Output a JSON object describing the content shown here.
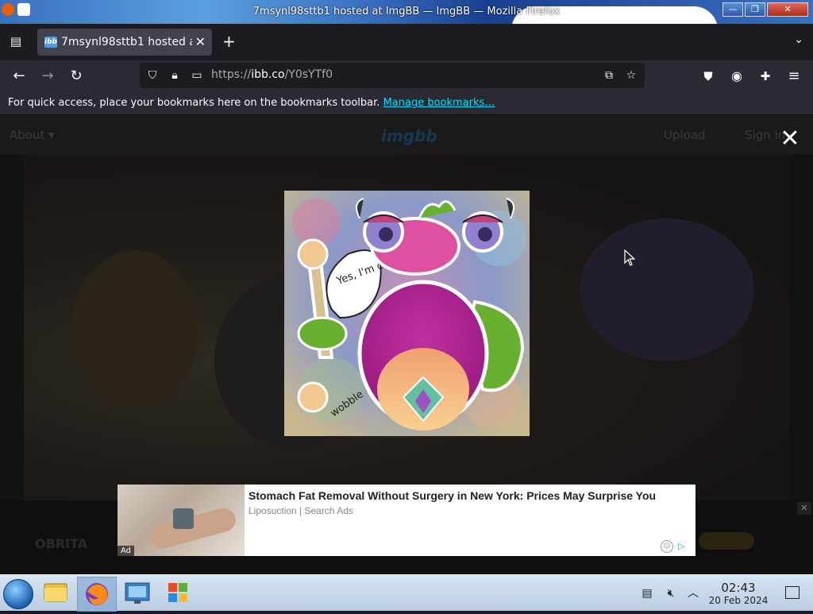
{
  "window": {
    "title": "7msynl98sttb1 hosted at ImgBB — ImgBB — Mozilla Firefox",
    "minimize": "—",
    "maximize": "❐",
    "close": "✕"
  },
  "tabs": [
    {
      "label": "7msynl98sttb1 hosted at ImgBB",
      "favicon": "ibb"
    }
  ],
  "toolbar": {
    "url_protocol": "https://",
    "url_host": "ibb.co",
    "url_path": "/Y0sYTf0"
  },
  "bookmarks_bar": {
    "message": "For quick access, place your bookmarks here on the bookmarks toolbar.",
    "link": "Manage bookmarks…"
  },
  "site": {
    "about": "About ▾",
    "logo": "imgbb",
    "upload": "Upload",
    "signin": "Sign in",
    "credit": "OBRITA"
  },
  "image": {
    "speech": "Yes, I'm chubby. And?",
    "signature": "wobble"
  },
  "ad": {
    "headline": "Stomach Fat Removal Without Surgery in New York: Prices May Surprise You",
    "source": "Liposuction | Search Ads",
    "label": "Ad"
  },
  "taskbar": {
    "time": "02:43",
    "date": "20 Feb 2024"
  }
}
